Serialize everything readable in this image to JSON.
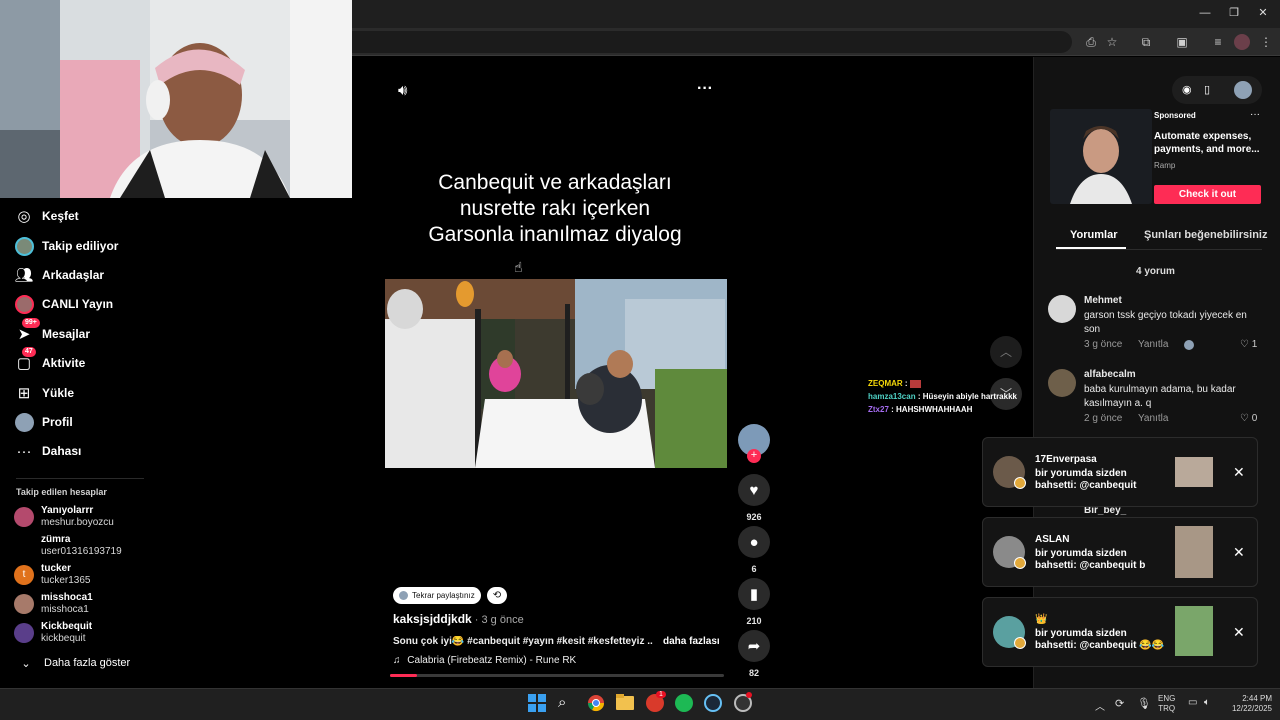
{
  "window_controls": {
    "minimize": "—",
    "restore": "❐",
    "close": "✕"
  },
  "video": {
    "overlay_text": [
      "Canbequit ve arkadaşları",
      "nusrette rakı içerken",
      "Garsonla inanılmaz diyalog"
    ],
    "reposted_label": "Tekrar paylaştınız",
    "author": "kaksjsjddjkdk",
    "time": " · 3 g önce",
    "description": "Sonu çok iyi😂 #canbequit #yayın #kesit #kesfetteyiz ...",
    "more_label": "daha fazlası",
    "music": "Calabria (Firebeatz Remix) - Rune RK",
    "likes": "926",
    "comments": "6",
    "saves": "210",
    "shares": "82",
    "progress": 0.08
  },
  "sidebar": {
    "nav": [
      {
        "label": "Keşfet"
      },
      {
        "label": "Takip ediliyor"
      },
      {
        "label": "Arkadaşlar"
      },
      {
        "label": "CANLI Yayın"
      },
      {
        "label": "Mesajlar",
        "badge": "99+"
      },
      {
        "label": "Aktivite",
        "badge": "47"
      },
      {
        "label": "Yükle"
      },
      {
        "label": "Profil"
      },
      {
        "label": "Dahası"
      }
    ],
    "following_header": "Takip edilen hesaplar",
    "accounts": [
      {
        "name": "Yanıyolarrr",
        "user": "meshur.boyozcu"
      },
      {
        "name": "zümra",
        "user": "user01316193719"
      },
      {
        "name": "tucker",
        "user": "tucker1365",
        "initial": "t"
      },
      {
        "name": "misshoca1",
        "user": "misshoca1"
      },
      {
        "name": "Kickbequit",
        "user": "kickbequit"
      }
    ],
    "show_more": "Daha fazla göster"
  },
  "chat": [
    {
      "user": "ZEQMAR",
      "text": "",
      "color": "#f5d90a"
    },
    {
      "user": "hamza13can",
      "text": "Hüseyin abiyle hartrakkk",
      "color": "#4fd1c5"
    },
    {
      "user": "Ztx27",
      "text": "HAHSHWHAHHAAH",
      "color": "#a56cf0"
    }
  ],
  "ad": {
    "sponsored": "Sponsored",
    "title": "Automate expenses, payments, and more...",
    "brand": "Ramp",
    "cta": "Check it out"
  },
  "tabs": {
    "comments": "Yorumlar",
    "recommended": "Şunları beğenebilirsiniz"
  },
  "comments_count": "4 yorum",
  "comments": [
    {
      "user": "Mehmet",
      "text": "garson tssk geçiyo tokadı yiyecek en son",
      "time": "3 g önce",
      "reply": "Yanıtla",
      "likes": "1"
    },
    {
      "user": "alfabecalm",
      "text": "baba kurulmayın adama, bu kadar kasılmayın a. q",
      "time": "2 g önce",
      "reply": "Yanıtla",
      "likes": "0"
    },
    {
      "user": "Bir_bey_",
      "text": "",
      "time": "",
      "reply": "",
      "likes": ""
    }
  ],
  "notifications": [
    {
      "user": "17Enverpasa",
      "body": "bir yorumda sizden bahsetti: @canbequit"
    },
    {
      "user": "ASLAN",
      "body": "bir yorumda sizden bahsetti: @canbequit b"
    },
    {
      "user": "👑",
      "body": "bir yorumda sizden bahsetti: @canbequit 😂😂"
    }
  ],
  "taskbar": {
    "lang1": "ENG",
    "lang2": "TRQ",
    "time": "2:44 PM",
    "date": "12/22/2025",
    "notification_count": "1"
  },
  "colors": {
    "accent": "#fe2c55",
    "chat_panel": "#000000"
  }
}
